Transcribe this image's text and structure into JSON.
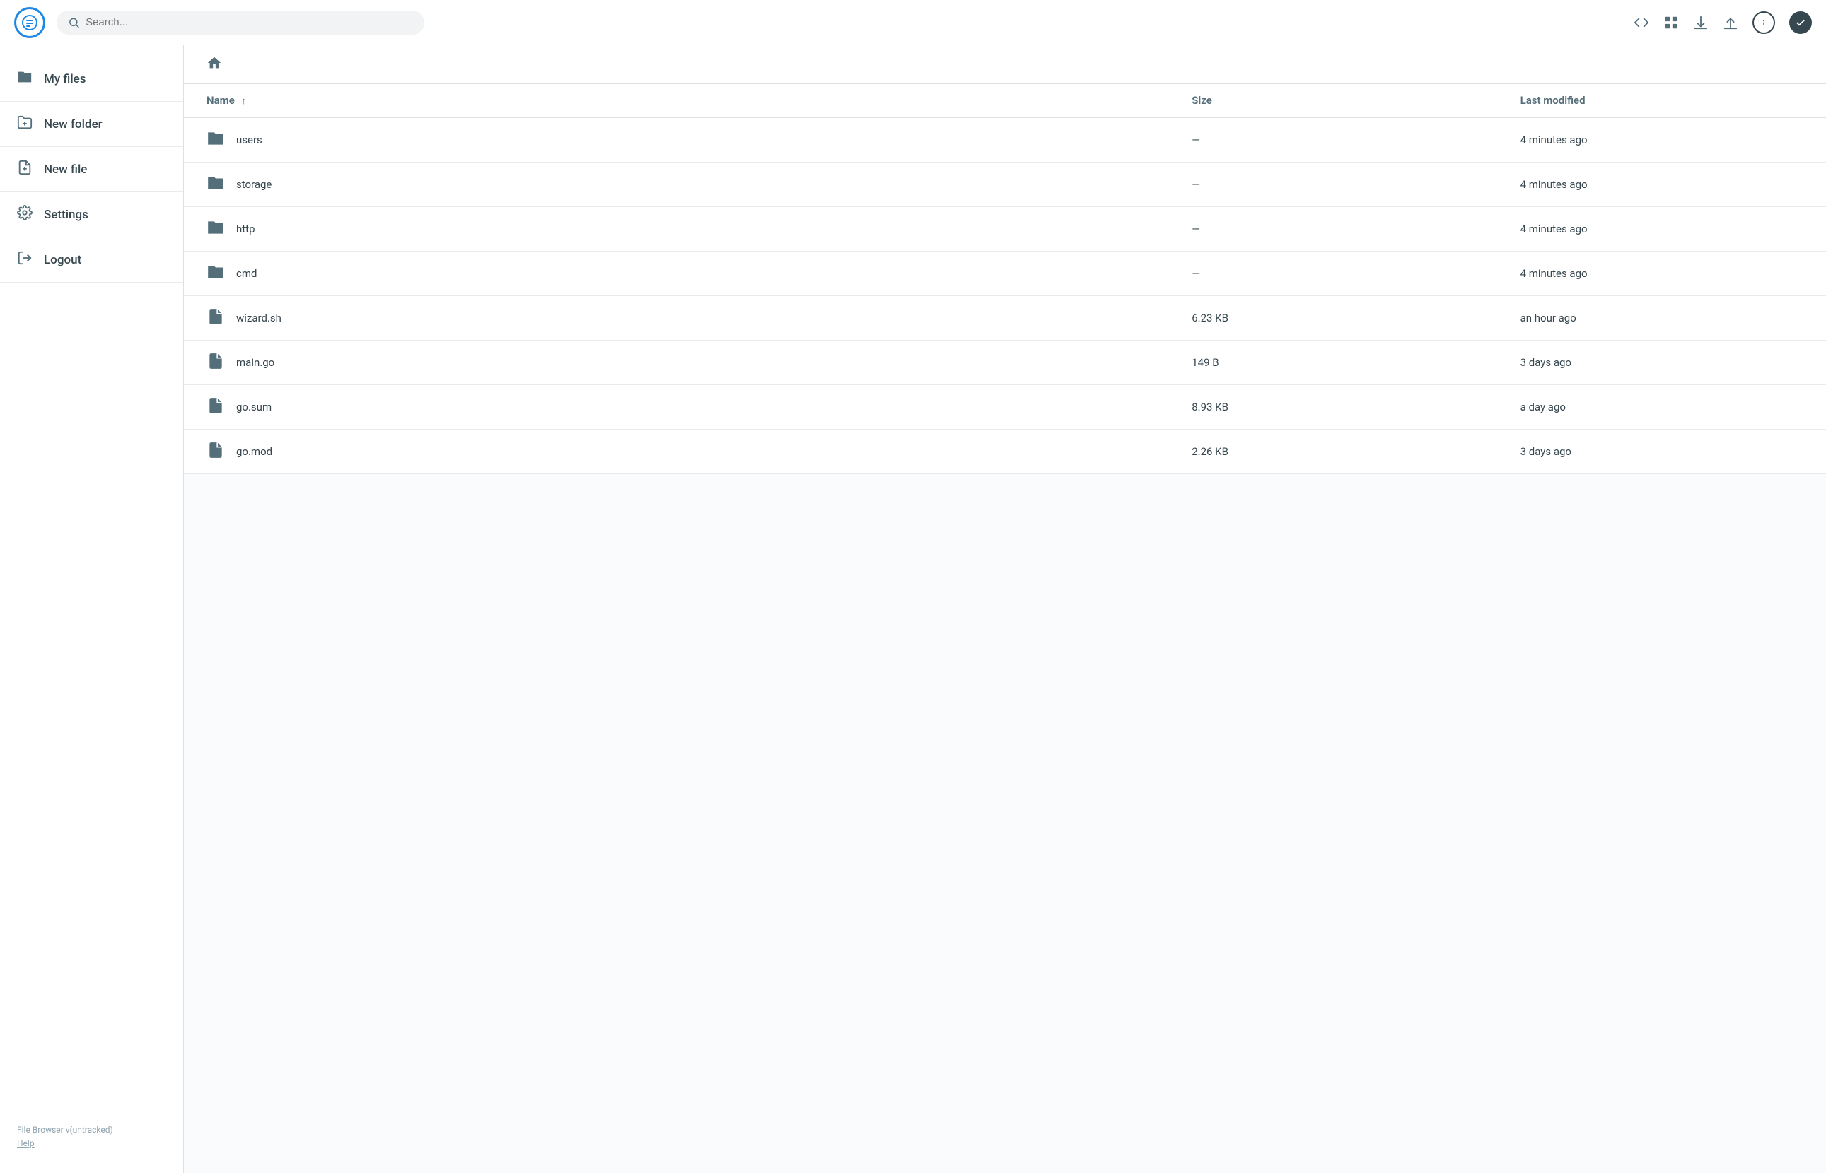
{
  "header": {
    "search_placeholder": "Search...",
    "logo_alt": "File Browser logo"
  },
  "sidebar": {
    "items": [
      {
        "id": "my-files",
        "label": "My files",
        "icon": "folder"
      },
      {
        "id": "new-folder",
        "label": "New folder",
        "icon": "new-folder"
      },
      {
        "id": "new-file",
        "label": "New file",
        "icon": "new-file"
      },
      {
        "id": "settings",
        "label": "Settings",
        "icon": "settings"
      },
      {
        "id": "logout",
        "label": "Logout",
        "icon": "logout"
      }
    ],
    "footer": {
      "version": "File Browser v(untracked)",
      "help": "Help"
    }
  },
  "table": {
    "columns": {
      "name": "Name",
      "size": "Size",
      "modified": "Last modified"
    },
    "rows": [
      {
        "id": 1,
        "type": "folder",
        "name": "users",
        "size": "—",
        "modified": "4 minutes ago"
      },
      {
        "id": 2,
        "type": "folder",
        "name": "storage",
        "size": "—",
        "modified": "4 minutes ago"
      },
      {
        "id": 3,
        "type": "folder",
        "name": "http",
        "size": "—",
        "modified": "4 minutes ago"
      },
      {
        "id": 4,
        "type": "folder",
        "name": "cmd",
        "size": "—",
        "modified": "4 minutes ago"
      },
      {
        "id": 5,
        "type": "file",
        "name": "wizard.sh",
        "size": "6.23 KB",
        "modified": "an hour ago"
      },
      {
        "id": 6,
        "type": "file",
        "name": "main.go",
        "size": "149 B",
        "modified": "3 days ago"
      },
      {
        "id": 7,
        "type": "file",
        "name": "go.sum",
        "size": "8.93 KB",
        "modified": "a day ago"
      },
      {
        "id": 8,
        "type": "file",
        "name": "go.mod",
        "size": "2.26 KB",
        "modified": "3 days ago"
      }
    ]
  }
}
